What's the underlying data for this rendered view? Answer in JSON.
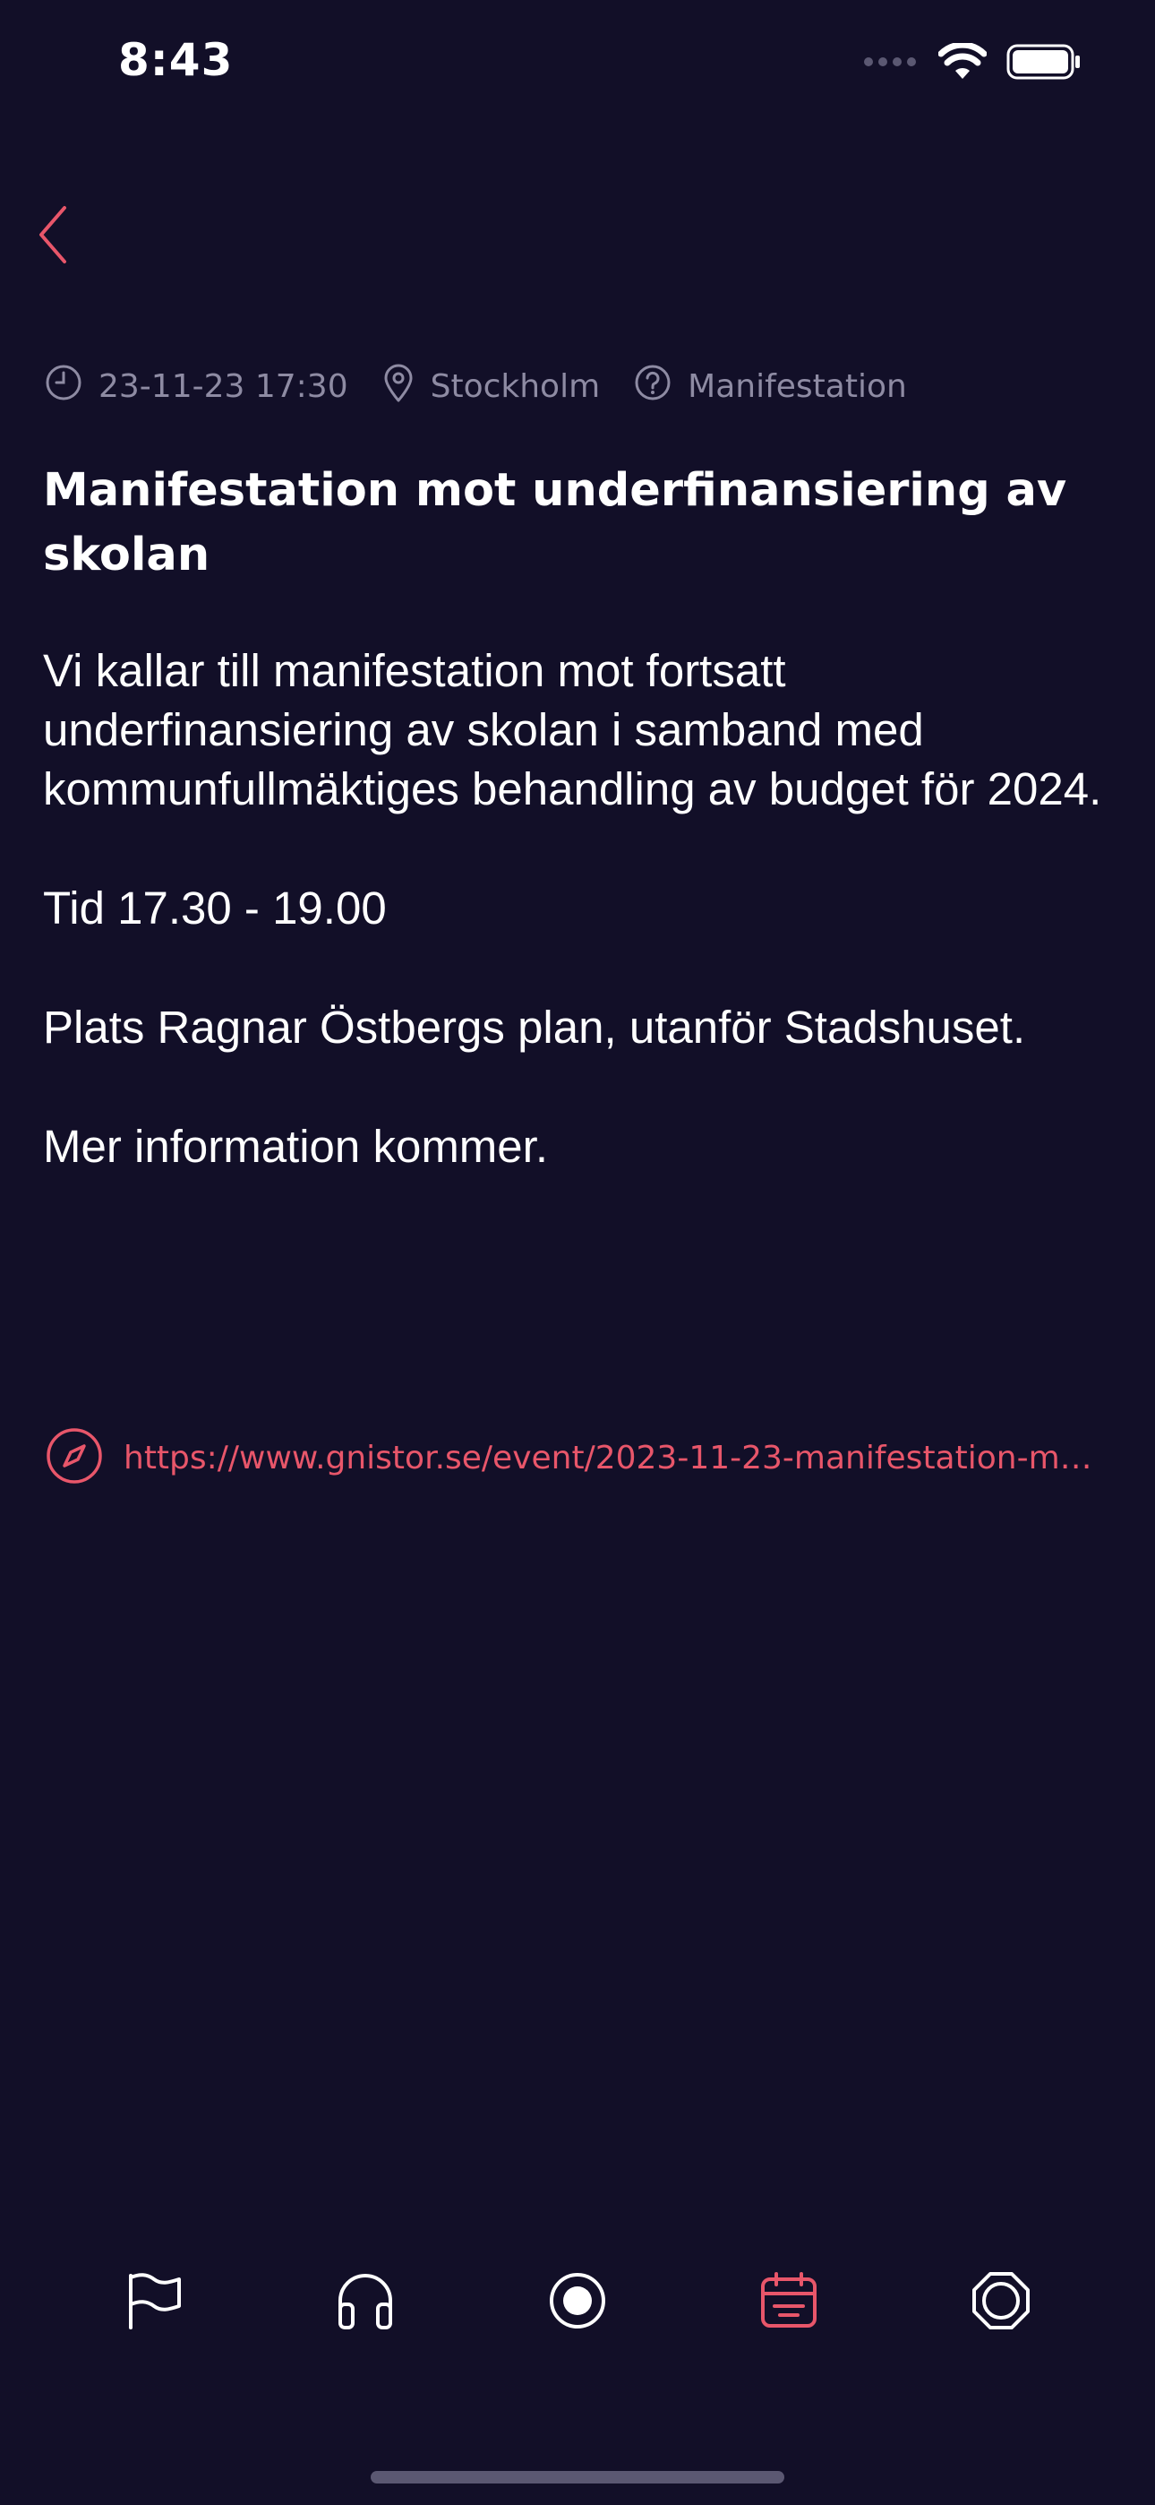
{
  "status_bar": {
    "time": "8:43"
  },
  "event": {
    "date": "23-11-23 17:30",
    "location": "Stockholm",
    "category": "Manifestation",
    "title": "Manifestation mot underfinansiering av skolan",
    "paragraphs": [
      "Vi kallar till manifestation mot fortsatt underfinansiering av skolan i samband med kommunfullmäktiges behandling av budget för 2024.",
      "Tid 17.30 - 19.00",
      "Plats Ragnar Östbergs plan, utanför Stadshuset.",
      "Mer information kommer."
    ],
    "link": "https://www.gnistor.se/event/2023-11-23-manifestation-m…"
  },
  "tab_bar": {
    "tabs": [
      {
        "icon": "flag-icon",
        "active": false
      },
      {
        "icon": "headphones-icon",
        "active": false
      },
      {
        "icon": "record-icon",
        "active": false
      },
      {
        "icon": "calendar-icon",
        "active": true
      },
      {
        "icon": "octagon-icon",
        "active": false
      }
    ]
  },
  "colors": {
    "background": "#120f28",
    "accent": "#e8566a",
    "muted": "#8e8ba3",
    "text": "#ffffff"
  }
}
